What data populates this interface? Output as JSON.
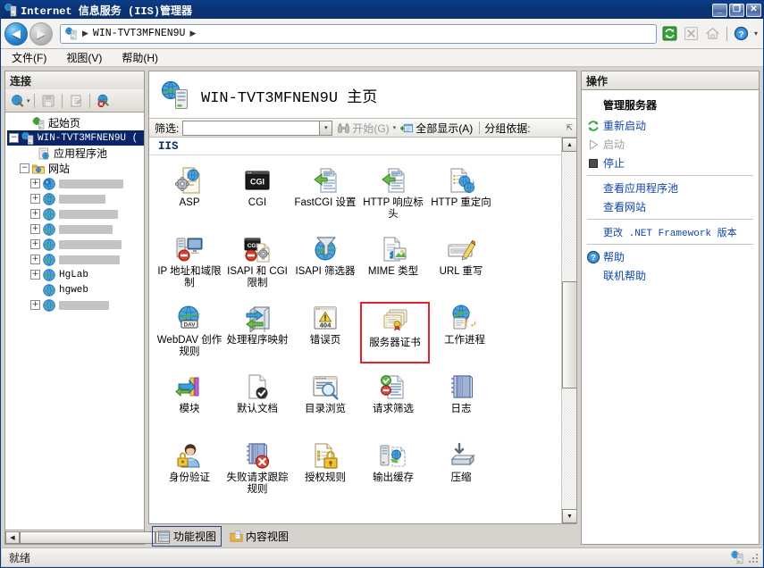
{
  "window": {
    "title": "Internet 信息服务 (IIS)管理器",
    "icon": "iis-server-icon",
    "buttons": {
      "minimize": "_",
      "maximize": "❐",
      "close": "✕"
    }
  },
  "nav": {
    "back_icon": "back-arrow-icon",
    "forward_icon": "forward-arrow-icon",
    "breadcrumb": {
      "icon": "server-icon",
      "path": "WIN-TVT3MFNEN9U",
      "separator": "▶"
    },
    "tools": [
      "refresh-icon",
      "stop-icon",
      "home-icon",
      "help-icon"
    ],
    "help_caret": "▾"
  },
  "menu": {
    "items": [
      {
        "label": "文件(F)",
        "name": "menu-file"
      },
      {
        "label": "视图(V)",
        "name": "menu-view"
      },
      {
        "label": "帮助(H)",
        "name": "menu-help"
      }
    ]
  },
  "connections": {
    "header": "连接",
    "toolbar": [
      "connect-to-icon",
      "save-icon",
      "edit-page-icon",
      "disconnect-icon"
    ],
    "toolbar_caret": "▾",
    "tree": [
      {
        "label": "起始页",
        "icon": "start-page-icon",
        "expander": "",
        "indent": 14,
        "selected": false,
        "redacted": false,
        "cjk": true
      },
      {
        "label": "WIN-TVT3MFNEN9U (",
        "icon": "server-icon",
        "expander": "−",
        "indent": 2,
        "selected": true,
        "redacted": false,
        "cjk": false
      },
      {
        "label": "应用程序池",
        "icon": "app-pool-icon",
        "expander": "",
        "indent": 20,
        "selected": false,
        "redacted": false,
        "cjk": true
      },
      {
        "label": "网站",
        "icon": "sites-folder-icon",
        "expander": "−",
        "indent": 14,
        "selected": false,
        "redacted": false,
        "cjk": true
      },
      {
        "label": "",
        "icon": "site-unknown-icon",
        "expander": "+",
        "indent": 26,
        "selected": false,
        "redacted": true,
        "redact_width": 72,
        "cjk": false
      },
      {
        "label": "",
        "icon": "site-icon",
        "expander": "+",
        "indent": 26,
        "selected": false,
        "redacted": true,
        "redact_width": 52,
        "cjk": false
      },
      {
        "label": "",
        "icon": "site-icon",
        "expander": "+",
        "indent": 26,
        "selected": false,
        "redacted": true,
        "redact_width": 66,
        "cjk": false
      },
      {
        "label": "",
        "icon": "site-icon",
        "expander": "+",
        "indent": 26,
        "selected": false,
        "redacted": true,
        "redact_width": 60,
        "cjk": false
      },
      {
        "label": "",
        "icon": "site-icon",
        "expander": "+",
        "indent": 26,
        "selected": false,
        "redacted": true,
        "redact_width": 70,
        "cjk": false
      },
      {
        "label": "",
        "icon": "site-icon",
        "expander": "+",
        "indent": 26,
        "selected": false,
        "redacted": true,
        "redact_width": 68,
        "cjk": false
      },
      {
        "label": "HgLab",
        "icon": "site-icon",
        "expander": "+",
        "indent": 26,
        "selected": false,
        "redacted": false,
        "cjk": false
      },
      {
        "label": "hgweb",
        "icon": "site-icon",
        "expander": "",
        "indent": 26,
        "selected": false,
        "redacted": false,
        "cjk": false
      },
      {
        "label": "",
        "icon": "site-icon",
        "expander": "+",
        "indent": 26,
        "selected": false,
        "redacted": true,
        "redact_width": 56,
        "cjk": false
      }
    ],
    "hscroll": {
      "left": "◀",
      "right": "▶"
    }
  },
  "main": {
    "page_title": "WIN-TVT3MFNEN9U 主页",
    "page_title_icon": "server-large-icon",
    "filter": {
      "label": "筛选:",
      "value": "",
      "placeholder": "",
      "dropdown_caret": "▾",
      "go_label": "开始(G)",
      "go_icon": "binoculars-icon",
      "go_caret": "▾",
      "showall_label": "全部显示(A)",
      "showall_icon": "show-all-icon",
      "groupby_label": "分组依据:",
      "overflow_caret": "⇱"
    },
    "group_header": "IIS",
    "features": [
      {
        "label": "ASP",
        "icon": "asp-icon",
        "highlighted": false
      },
      {
        "label": "CGI",
        "icon": "cgi-icon",
        "highlighted": false
      },
      {
        "label": "FastCGI 设置",
        "icon": "fastcgi-settings-icon",
        "highlighted": false
      },
      {
        "label": "HTTP 响应标头",
        "icon": "http-response-headers-icon",
        "highlighted": false
      },
      {
        "label": "HTTP 重定向",
        "icon": "http-redirect-icon",
        "highlighted": false
      },
      {
        "label": "IP 地址和域限制",
        "icon": "ip-address-domain-restrictions-icon",
        "highlighted": false
      },
      {
        "label": "ISAPI 和 CGI 限制",
        "icon": "isapi-cgi-restrictions-icon",
        "highlighted": false
      },
      {
        "label": "ISAPI 筛选器",
        "icon": "isapi-filters-icon",
        "highlighted": false
      },
      {
        "label": "MIME 类型",
        "icon": "mime-types-icon",
        "highlighted": false
      },
      {
        "label": "URL 重写",
        "icon": "url-rewrite-icon",
        "highlighted": false
      },
      {
        "label": "WebDAV 创作规则",
        "icon": "webdav-authoring-rules-icon",
        "highlighted": false
      },
      {
        "label": "处理程序映射",
        "icon": "handler-mappings-icon",
        "highlighted": false
      },
      {
        "label": "错误页",
        "icon": "error-pages-icon",
        "highlighted": false
      },
      {
        "label": "服务器证书",
        "icon": "server-certificates-icon",
        "highlighted": true
      },
      {
        "label": "工作进程",
        "icon": "worker-processes-icon",
        "highlighted": false
      },
      {
        "label": "模块",
        "icon": "modules-icon",
        "highlighted": false
      },
      {
        "label": "默认文档",
        "icon": "default-document-icon",
        "highlighted": false
      },
      {
        "label": "目录浏览",
        "icon": "directory-browsing-icon",
        "highlighted": false
      },
      {
        "label": "请求筛选",
        "icon": "request-filtering-icon",
        "highlighted": false
      },
      {
        "label": "日志",
        "icon": "logging-icon",
        "highlighted": false
      },
      {
        "label": "身份验证",
        "icon": "authentication-icon",
        "highlighted": false
      },
      {
        "label": "失败请求跟踪规则",
        "icon": "failed-request-tracing-rules-icon",
        "highlighted": false
      },
      {
        "label": "授权规则",
        "icon": "authorization-rules-icon",
        "highlighted": false
      },
      {
        "label": "输出缓存",
        "icon": "output-caching-icon",
        "highlighted": false
      },
      {
        "label": "压缩",
        "icon": "compression-icon",
        "highlighted": false
      }
    ],
    "highlight_color": "#e8202a",
    "scroll": {
      "up": "▲",
      "down": "▼"
    },
    "view_tabs": [
      {
        "label": "功能视图",
        "icon": "features-view-icon",
        "active": true
      },
      {
        "label": "内容视图",
        "icon": "content-view-icon",
        "active": false
      }
    ]
  },
  "actions": {
    "header": "操作",
    "group_title": "管理服务器",
    "items": [
      {
        "label": "重新启动",
        "icon": "restart-icon",
        "disabled": false,
        "mono": false
      },
      {
        "label": "启动",
        "icon": "start-icon",
        "disabled": true,
        "mono": false
      },
      {
        "label": "停止",
        "icon": "stop-square-icon",
        "disabled": false,
        "mono": false
      },
      {
        "divider": true
      },
      {
        "label": "查看应用程序池",
        "icon": "",
        "disabled": false,
        "mono": false
      },
      {
        "label": "查看网站",
        "icon": "",
        "disabled": false,
        "mono": false
      },
      {
        "divider": true
      },
      {
        "label": "更改 .NET Framework 版本",
        "icon": "",
        "disabled": false,
        "mono": true
      },
      {
        "divider": true
      },
      {
        "label": "帮助",
        "icon": "help-circle-icon",
        "disabled": false,
        "mono": false
      },
      {
        "label": "联机帮助",
        "icon": "",
        "disabled": false,
        "mono": false
      }
    ]
  },
  "statusbar": {
    "text": "就绪",
    "icon": "server-small-icon",
    "grip": "resize-grip"
  }
}
